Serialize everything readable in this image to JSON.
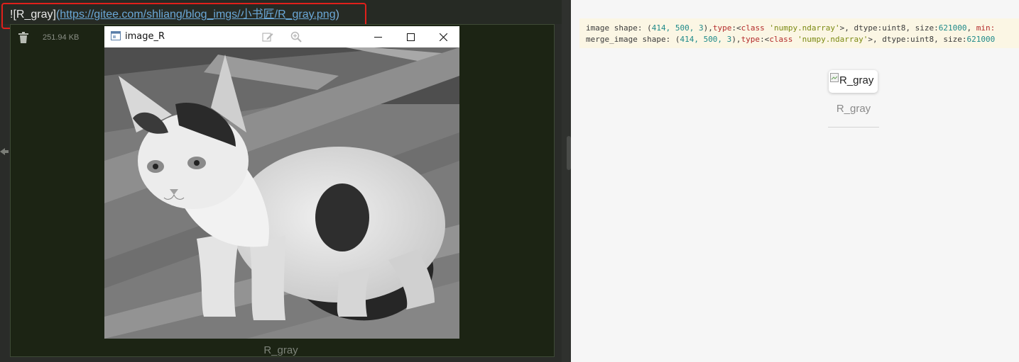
{
  "editor": {
    "markdown": {
      "bang": "!",
      "open_bracket": "[",
      "alt": "R_gray",
      "close_bracket": "]",
      "open_paren": "(",
      "url": "https://gitee.com/shliang/blog_imgs/小书匠/R_gray.png",
      "close_paren": ")"
    },
    "file_size": "251.94 KB",
    "caption": "R_gray",
    "icons": {
      "delete": "trash-icon",
      "edge": "arrow-left-icon"
    }
  },
  "image_window": {
    "title": "image_R",
    "icons": [
      "app-window-icon",
      "edit-icon",
      "zoom-icon",
      "minimize-icon",
      "maximize-icon",
      "close-icon"
    ],
    "image_description_colors": {
      "background": "#777777",
      "subject": "#e6e6e6"
    }
  },
  "preview": {
    "code_lines": [
      {
        "prefix": "image shape: (",
        "nums": "414, 500, 3",
        "mid": "),",
        "kw": "type",
        "colon": ":<",
        "cls": "class",
        "sp": " ",
        "str": "'numpy.ndarray'",
        "tail": ">, dtype:uint8, size:",
        "size": "621000",
        "end": ", ",
        "extra": "min:"
      },
      {
        "prefix": "merge_image shape: (",
        "nums": "414, 500, 3",
        "mid": "),",
        "kw": "type",
        "colon": ":<",
        "cls": "class",
        "sp": " ",
        "str": "'numpy.ndarray'",
        "tail": ">, dtype:uint8, size:",
        "size": "621000",
        "end": "",
        "extra": ""
      }
    ],
    "image_alt": "R_gray",
    "caption": "R_gray"
  },
  "colors": {
    "editor_bg": "#2a2c29",
    "panel_bg": "#1c2414",
    "highlight": "#e0201b",
    "link": "#6aa7d6",
    "preview_bg": "#f6f6f6",
    "code_bg": "#fbf6e4"
  }
}
